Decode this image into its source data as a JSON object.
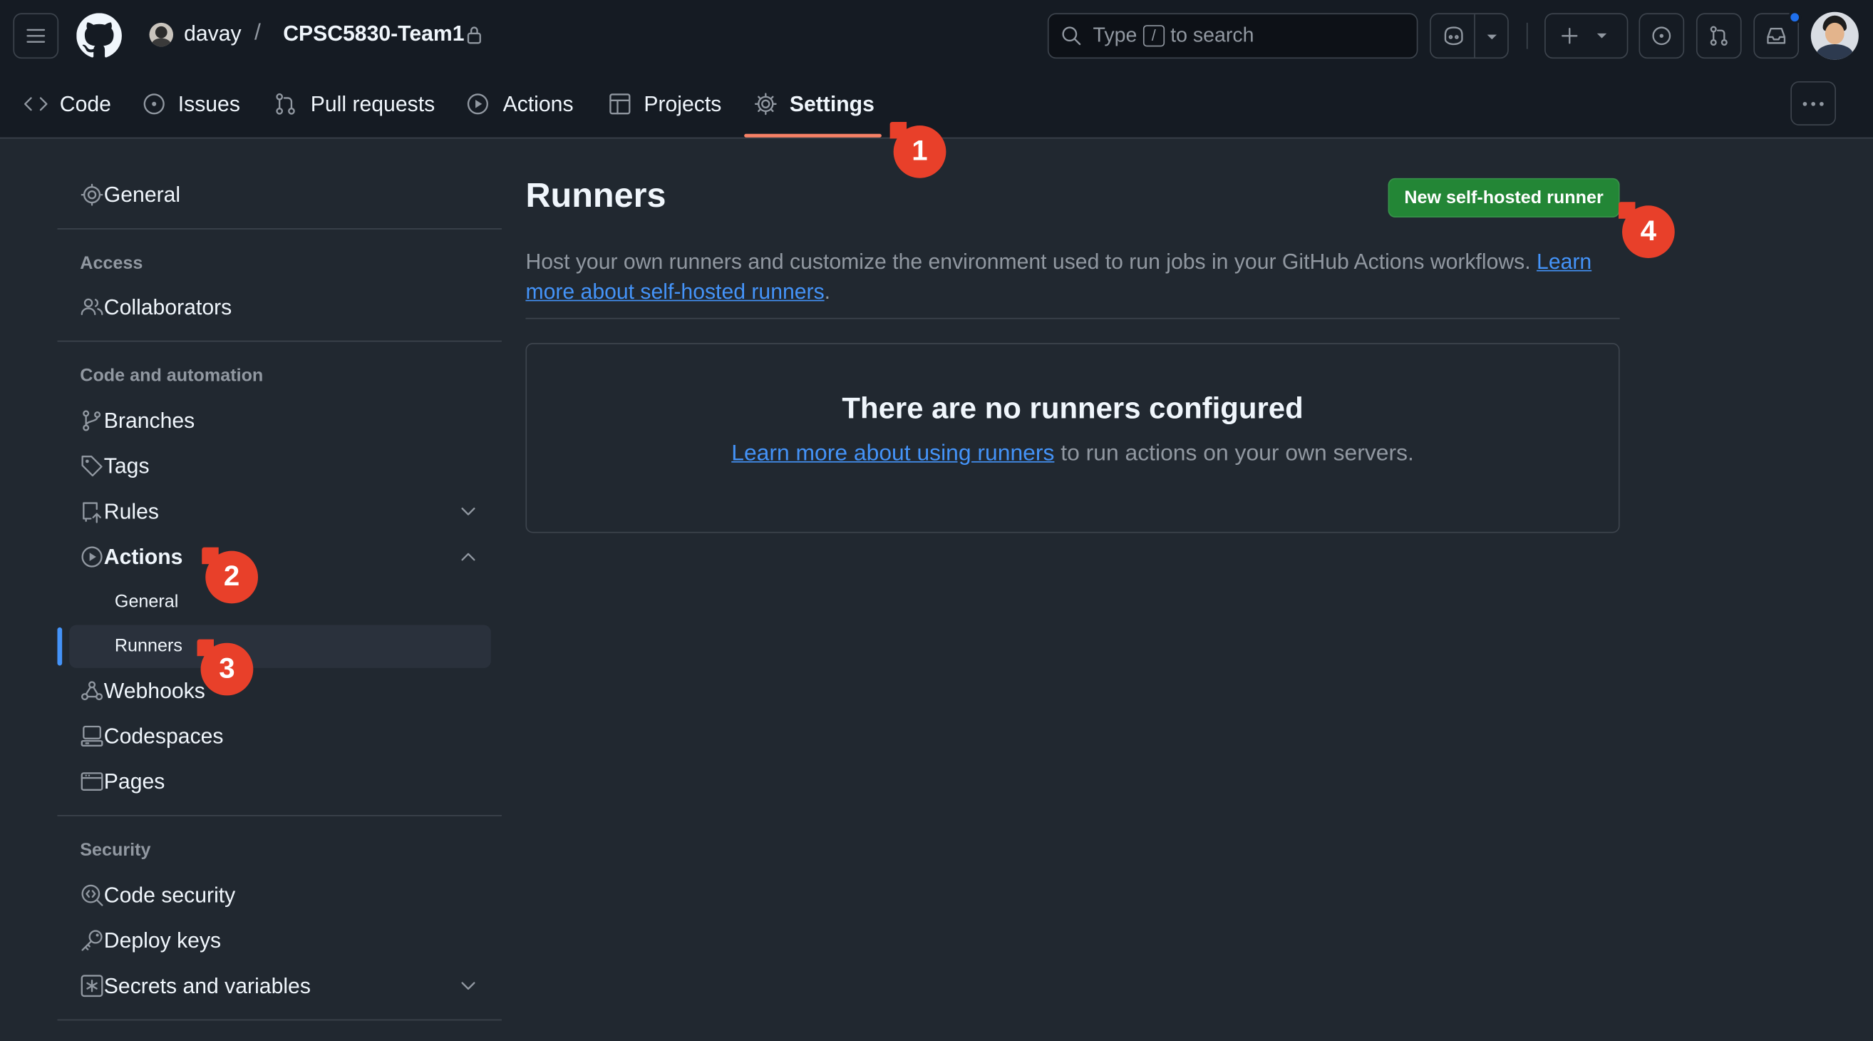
{
  "header": {
    "repo_owner": "davay",
    "repo_separator": "/",
    "repo_name": "CPSC5830-Team1",
    "search_prefix": "Type",
    "search_key": "/",
    "search_suffix": "to search"
  },
  "repo_tabs": [
    {
      "label": "Code",
      "icon": "code-icon"
    },
    {
      "label": "Issues",
      "icon": "issue-icon"
    },
    {
      "label": "Pull requests",
      "icon": "pull-request-icon"
    },
    {
      "label": "Actions",
      "icon": "play-icon"
    },
    {
      "label": "Projects",
      "icon": "table-icon"
    },
    {
      "label": "Settings",
      "icon": "gear-icon",
      "active": true
    }
  ],
  "sidebar": {
    "general": "General",
    "access_heading": "Access",
    "collaborators": "Collaborators",
    "code_heading": "Code and automation",
    "branches": "Branches",
    "tags": "Tags",
    "rules": "Rules",
    "actions": "Actions",
    "actions_general": "General",
    "actions_runners": "Runners",
    "webhooks": "Webhooks",
    "codespaces": "Codespaces",
    "pages": "Pages",
    "security_heading": "Security",
    "code_security": "Code security",
    "deploy_keys": "Deploy keys",
    "secrets": "Secrets and variables"
  },
  "main": {
    "title": "Runners",
    "new_button": "New self-hosted runner",
    "description": "Host your own runners and customize the environment used to run jobs in your GitHub Actions workflows.",
    "description_link": "Learn more about self-hosted runners",
    "description_end": ".",
    "blank_title": "There are no runners configured",
    "blank_link": "Learn more about using runners",
    "blank_text": "to run actions on your own servers."
  },
  "markers": [
    "1",
    "2",
    "3",
    "4"
  ],
  "colors": {
    "background": "#212830",
    "header": "#151b23",
    "accent_link": "#4493f8",
    "primary_button": "#238636",
    "active_tab_underline": "#f78166",
    "selected_indicator": "#4493f8",
    "annotation_marker": "#e8402a"
  }
}
